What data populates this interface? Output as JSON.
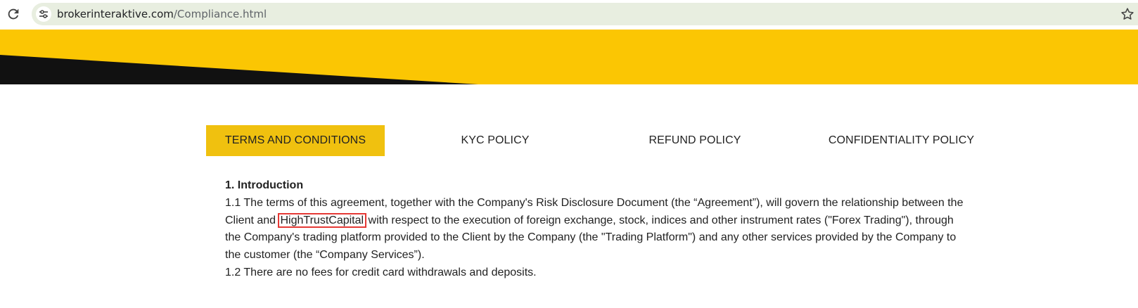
{
  "browser": {
    "reload_icon": "reload-icon",
    "site_info_icon": "tune-icon",
    "url_domain": "brokerinteraktive.com",
    "url_path": "/Compliance.html",
    "bookmark_icon": "star-icon"
  },
  "banner": {
    "colors": {
      "yellow": "#fbc603",
      "black": "#111111"
    }
  },
  "tabs": [
    {
      "label": "TERMS AND CONDITIONS",
      "active": true
    },
    {
      "label": "KYC POLICY",
      "active": false
    },
    {
      "label": "REFUND POLICY",
      "active": false
    },
    {
      "label": "CONFIDENTIALITY POLICY",
      "active": false
    }
  ],
  "content": {
    "heading": "1. Introduction",
    "p1_before": "1.1 The terms of this agreement, together with the Company's Risk Disclosure Document (the “Agreement”), will govern the relationship between the Client and",
    "p1_highlight": "HighTrustCapital",
    "p1_after": "with respect to the execution of foreign exchange, stock, indices and other instrument rates (\"Forex Trading\"), through the Company's trading platform provided to the Client by the Company (the \"Trading Platform\") and any other services provided by the Company to the customer (the “Company Services”).",
    "p2": "1.2 There are no fees for credit card withdrawals and deposits."
  },
  "colors": {
    "active_tab": "#f0c10f",
    "highlight_box": "#e53935"
  }
}
